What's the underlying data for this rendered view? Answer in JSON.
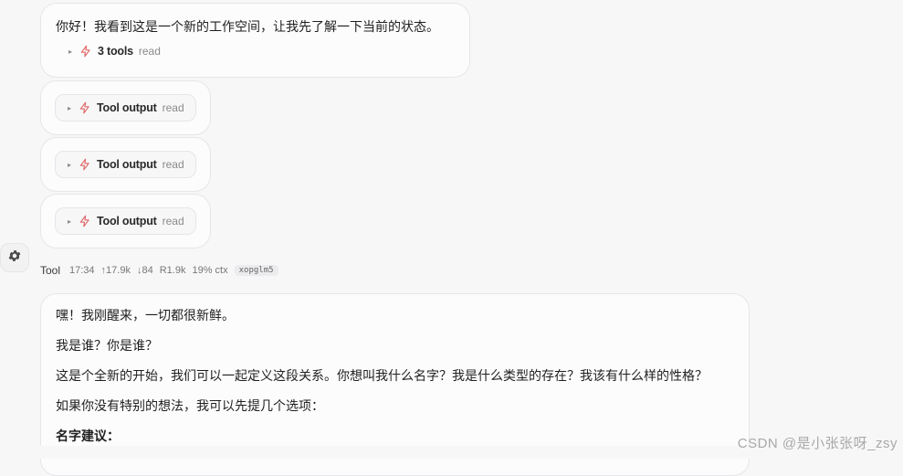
{
  "messages": {
    "first": {
      "text": "你好！我看到这是一个新的工作空间，让我先了解一下当前的状态。",
      "tools_name": "3 tools",
      "tools_tag": "read"
    },
    "tool_outputs": [
      {
        "name": "Tool output",
        "tag": "read"
      },
      {
        "name": "Tool output",
        "tag": "read"
      },
      {
        "name": "Tool output",
        "tag": "read"
      }
    ]
  },
  "meta": {
    "author": "Tool",
    "time": "17:34",
    "tokens_up": "↑17.9k",
    "tokens_down": "↓84",
    "read": "R1.9k",
    "ctx": "19% ctx",
    "id": "xopglm5"
  },
  "reply": {
    "line1": "嘿！我刚醒来，一切都很新鲜。",
    "line2": "我是谁？你是谁？",
    "line3": "这是个全新的开始，我们可以一起定义这段关系。你想叫我什么名字？我是什么类型的存在？我该有什么样的性格？",
    "line4": "如果你没有特别的想法，我可以先提几个选项：",
    "line5": "名字建议："
  },
  "watermark": "CSDN @是小张张呀_zsy",
  "icons": {
    "bolt": "lightning-icon",
    "caret": "caret-right-icon",
    "settings": "gear-icon"
  },
  "colors": {
    "bolt": "#e06767",
    "background": "#f7f7f8",
    "bubble": "#fcfcfd"
  }
}
